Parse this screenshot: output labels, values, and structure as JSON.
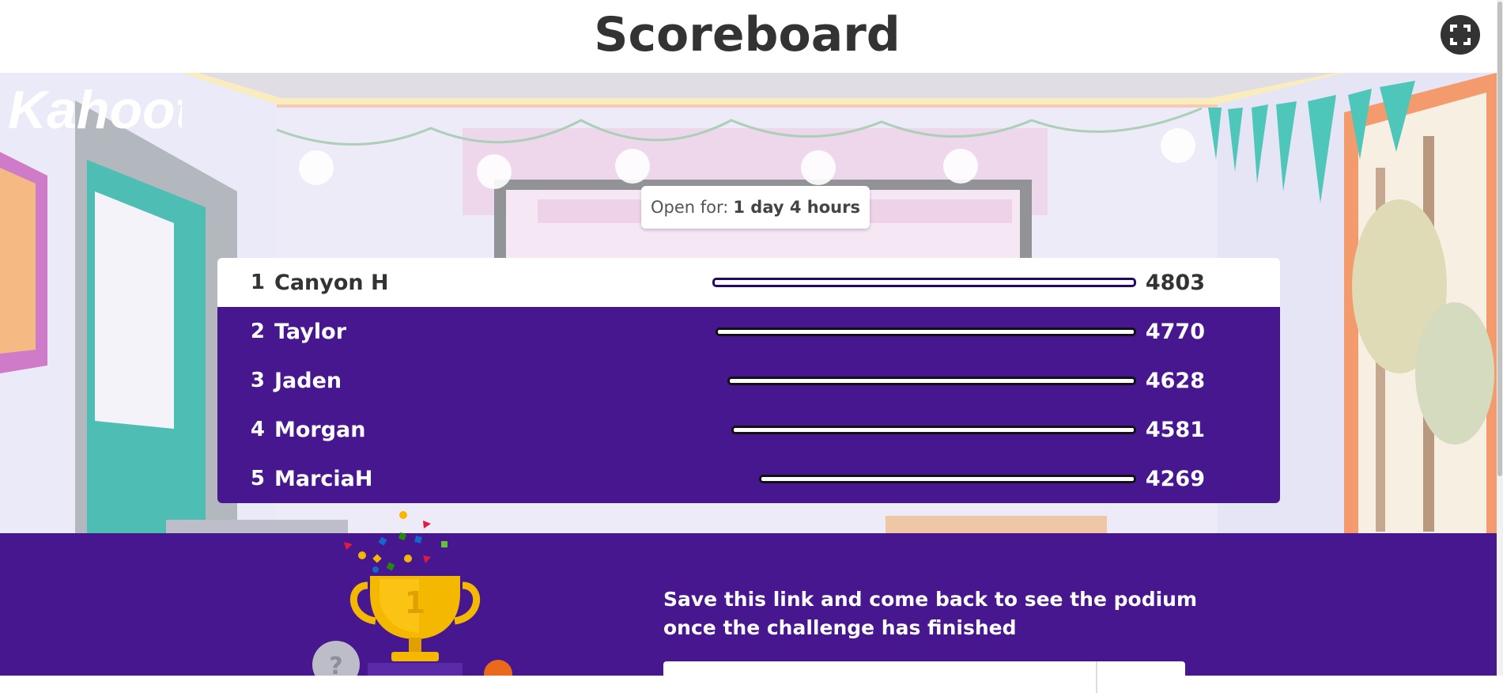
{
  "header": {
    "title": "Scoreboard",
    "fullscreen_icon": "fullscreen-icon"
  },
  "banner": {
    "logo_text": "Kahoot!",
    "open_for_label": "Open for:",
    "open_for_value": "1 day 4 hours"
  },
  "scoreboard": {
    "max_score": 4803,
    "players": [
      {
        "rank": "1",
        "name": "Canyon H",
        "score": 4803
      },
      {
        "rank": "2",
        "name": "Taylor",
        "score": 4770
      },
      {
        "rank": "3",
        "name": "Jaden",
        "score": 4628
      },
      {
        "rank": "4",
        "name": "Morgan",
        "score": 4581
      },
      {
        "rank": "5",
        "name": "MarciaH",
        "score": 4269
      }
    ]
  },
  "footer": {
    "save_message": "Save this link and come back to see the podium once the challenge has finished",
    "trophy_icon": "trophy-icon",
    "trophy_rank": "1",
    "second_place_label": "?"
  },
  "colors": {
    "brand_purple": "#46178f",
    "text_dark": "#333333",
    "trophy_gold": "#f5b800"
  }
}
